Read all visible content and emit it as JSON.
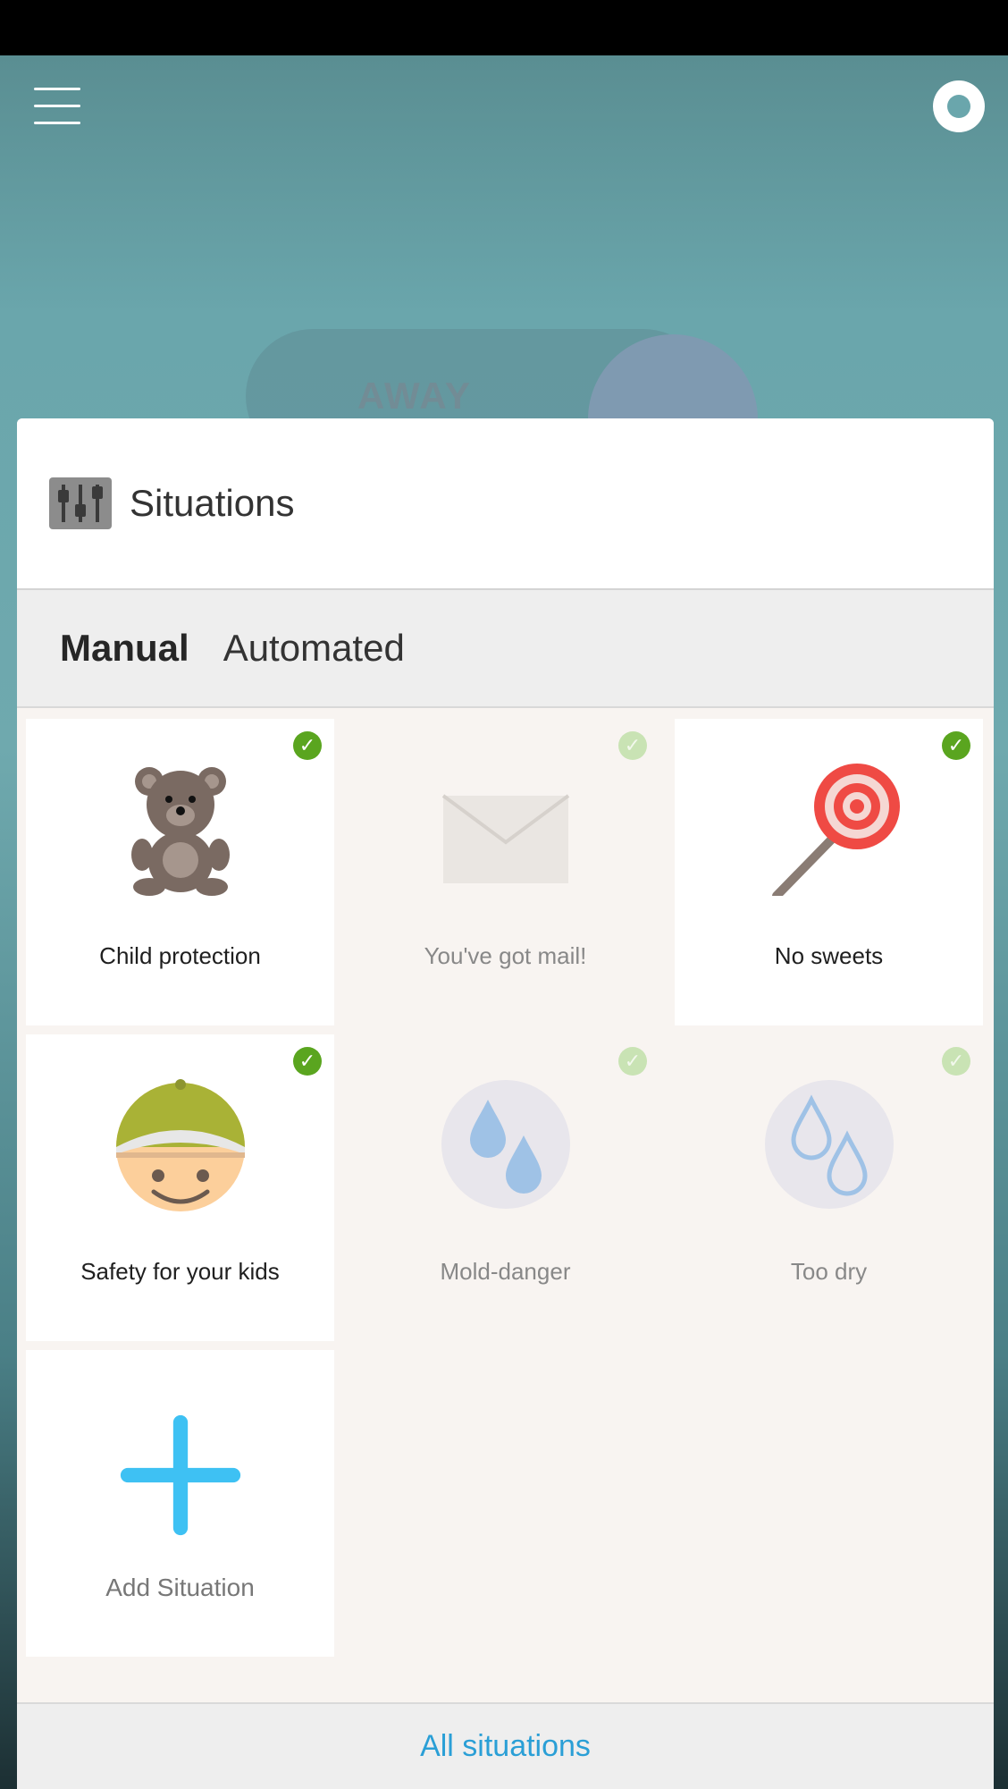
{
  "header": {
    "menu_icon": "hamburger-menu-icon",
    "nav_icon": "directional-pad-icon"
  },
  "background": {
    "mode_label": "AWAY"
  },
  "sheet": {
    "title": "Situations",
    "title_icon": "equalizer-sliders-icon",
    "tabs": [
      {
        "label": "Manual",
        "active": true
      },
      {
        "label": "Automated",
        "active": false
      }
    ],
    "tiles": [
      {
        "label": "Child protection",
        "icon": "teddy-bear-icon",
        "active": true
      },
      {
        "label": "You've got mail!",
        "icon": "envelope-icon",
        "active": false
      },
      {
        "label": "No sweets",
        "icon": "lollipop-icon",
        "active": true
      },
      {
        "label": "Safety for your kids",
        "icon": "kid-face-icon",
        "active": true
      },
      {
        "label": "Mold-danger",
        "icon": "water-drops-icon",
        "active": false
      },
      {
        "label": "Too dry",
        "icon": "outline-drops-icon",
        "active": false
      }
    ],
    "add_tile": {
      "label": "Add Situation",
      "icon": "plus-icon"
    },
    "footer_link": "All situations"
  },
  "colors": {
    "check_active": "#5aa51f",
    "check_inactive": "#c9e3b4",
    "link": "#2a9fd6",
    "add_plus": "#3ec1f3"
  }
}
